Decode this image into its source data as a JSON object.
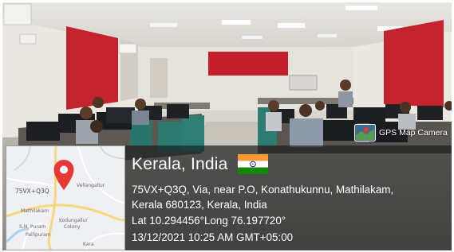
{
  "badge": {
    "text": "GPS Map Camera"
  },
  "map": {
    "code_label": "75VX+Q3Q",
    "place_labels": [
      "Vellangallur",
      "Mathilakam",
      "Kodungallur",
      "Colony",
      "S.N. Puram",
      "Pallipuram",
      "Kara"
    ]
  },
  "location": {
    "title": "Kerala, India",
    "address_line1": "75VX+Q3Q, Via, near P.O, Konathukunnu, Mathilakam,",
    "address_line2": "Kerala 680123, Kerala, India",
    "coordinates": "Lat 10.294456°Long 76.197720°",
    "datetime": "13/12/2021 10:25 AM GMT+05:00"
  }
}
